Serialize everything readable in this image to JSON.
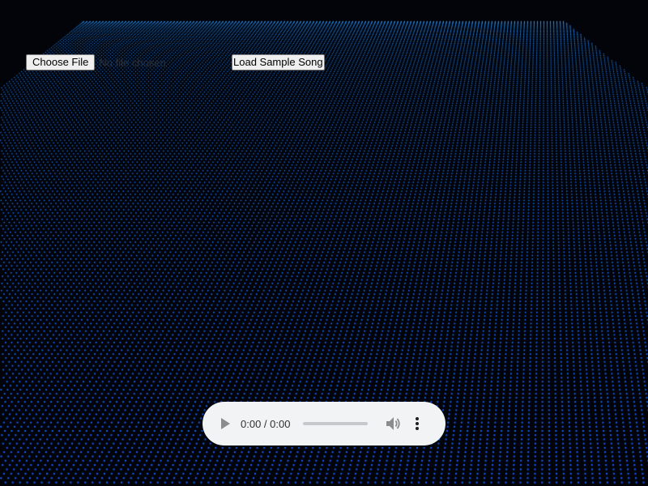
{
  "upload": {
    "choose_label": "Choose File",
    "status": "No file chosen"
  },
  "sample": {
    "label": "Load Sample Song"
  },
  "audio": {
    "time": "0:00 / 0:00",
    "progress": 0
  },
  "icons": {
    "play": "play-icon",
    "volume": "volume-icon",
    "menu": "more-vert-icon"
  },
  "colors": {
    "background": "#02040a",
    "dot": "#2a7fff",
    "player_bg": "#f1f3f4"
  }
}
